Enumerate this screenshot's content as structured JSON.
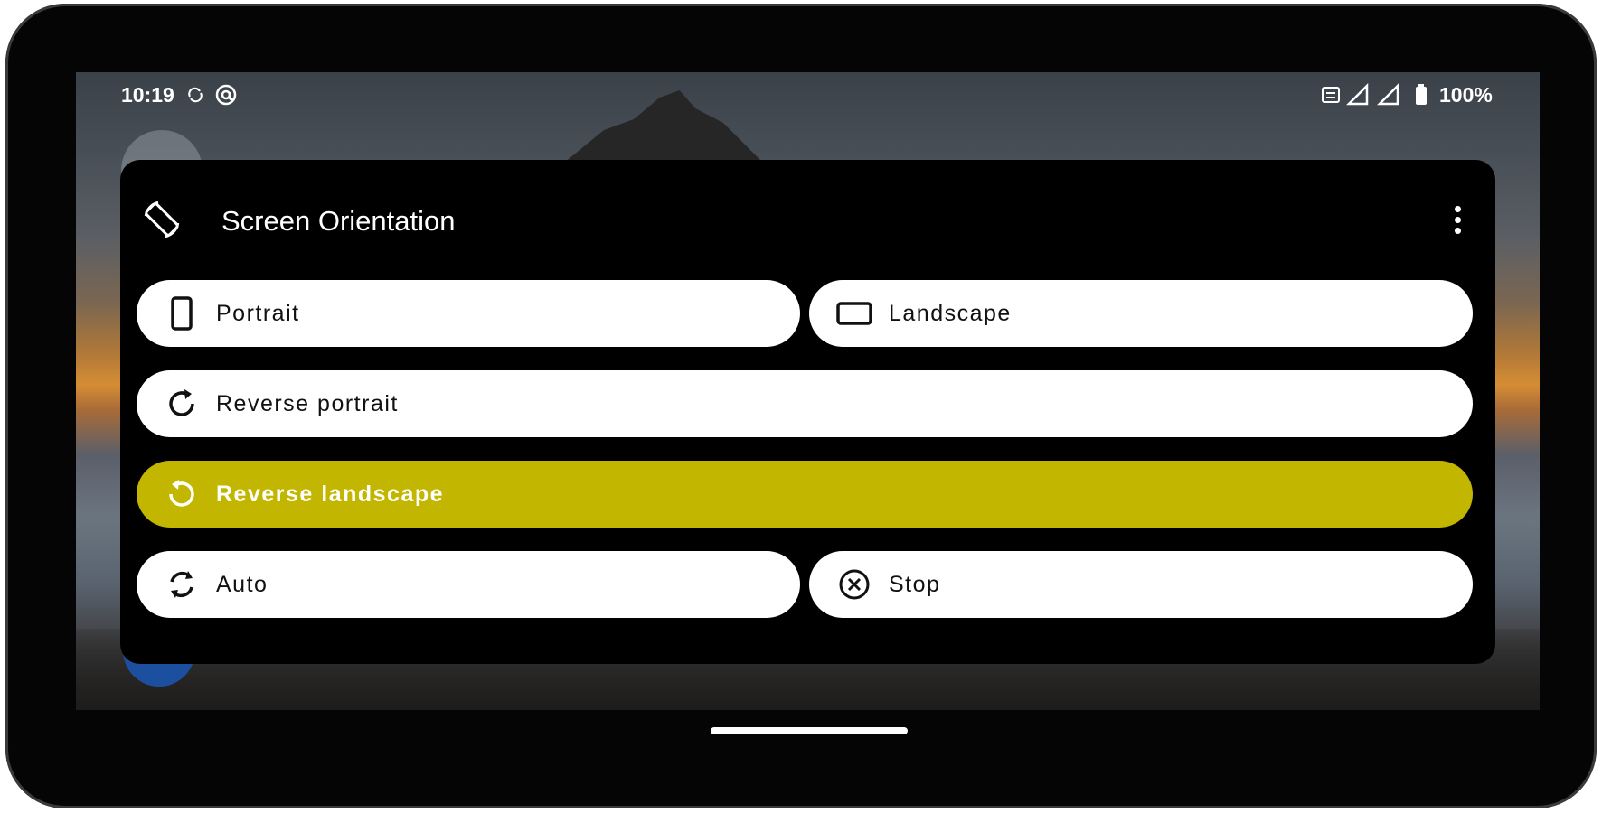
{
  "status_bar": {
    "time": "10:19",
    "battery": "100%",
    "icons": [
      "sync-icon",
      "at-icon",
      "data-icon",
      "signal-icon",
      "signal-icon",
      "battery-icon"
    ]
  },
  "dialog": {
    "title": "Screen Orientation",
    "header_icon": "screen-rotation-icon",
    "menu_icon": "more-vert-icon",
    "options": [
      {
        "label": "Portrait",
        "icon": "portrait-icon",
        "selected": false
      },
      {
        "label": "Landscape",
        "icon": "landscape-icon",
        "selected": false
      },
      {
        "label": "Reverse portrait",
        "icon": "rotate-right-icon",
        "selected": false
      },
      {
        "label": "Reverse landscape",
        "icon": "rotate-left-icon",
        "selected": true
      },
      {
        "label": "Auto",
        "icon": "auto-rotate-icon",
        "selected": false
      },
      {
        "label": "Stop",
        "icon": "close-circle-icon",
        "selected": false
      }
    ]
  },
  "colors": {
    "selected": "#c3b600",
    "button_bg": "#ffffff",
    "dialog_bg": "#000000"
  }
}
